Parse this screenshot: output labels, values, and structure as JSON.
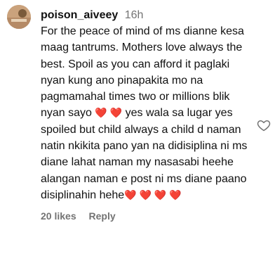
{
  "comment": {
    "username": "poison_aiveey",
    "time": "16h",
    "text_part1": "For the peace of mind of ms dianne kesa maag tantrums. Mothers love always the best. Spoil as you can afford it paglaki nyan kung ano pinapakita mo na pagmamahal times two or millions blik nyan sayo ",
    "text_part2": " yes wala sa lugar yes spoiled but child always a child d naman natin nkikita pano yan na didisiplina ni ms diane lahat naman my nasasabi heehe alangan naman e post ni ms diane paano disiplinahin hehe",
    "hearts_mid": "❤️ ❤️",
    "hearts_end": "❤️ ❤️ ❤️ ❤️",
    "likes_label": "20 likes",
    "reply_label": "Reply"
  },
  "colors": {
    "heart": "#e0245e",
    "secondary_text": "#737373"
  },
  "icons": {
    "like": "heart-outline-icon",
    "avatar": "user-avatar"
  }
}
